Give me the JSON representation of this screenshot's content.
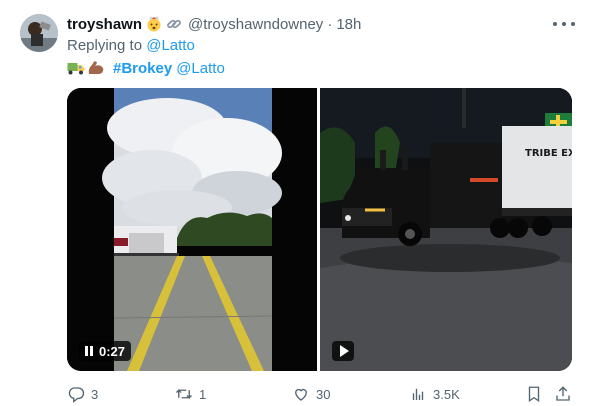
{
  "tweet": {
    "author_name": "troyshawn",
    "author_emoji_icons": [
      "exploding-head-emoji-icon",
      "link-emoji-icon"
    ],
    "author_handle": "@troyshawndowney",
    "separator": "·",
    "timestamp": "18h",
    "reply_prefix": "Replying to",
    "reply_to": "@Latto",
    "body_emoji_icons": [
      "truck-emoji-icon",
      "flexed-biceps-emoji-icon"
    ],
    "hashtag": "#Brokey",
    "mention": "@Latto"
  },
  "media": {
    "left_video": {
      "duration": "0:27",
      "state": "pause-icon"
    },
    "right_video": {
      "state": "play-icon",
      "trailer_text": "TRIBE EXPR"
    }
  },
  "actions": {
    "replies": "3",
    "retweets": "1",
    "likes": "30",
    "views": "3.5K"
  },
  "colors": {
    "accent": "#1d9bf0",
    "secondary_text": "#536471",
    "primary_text": "#0f1419"
  }
}
